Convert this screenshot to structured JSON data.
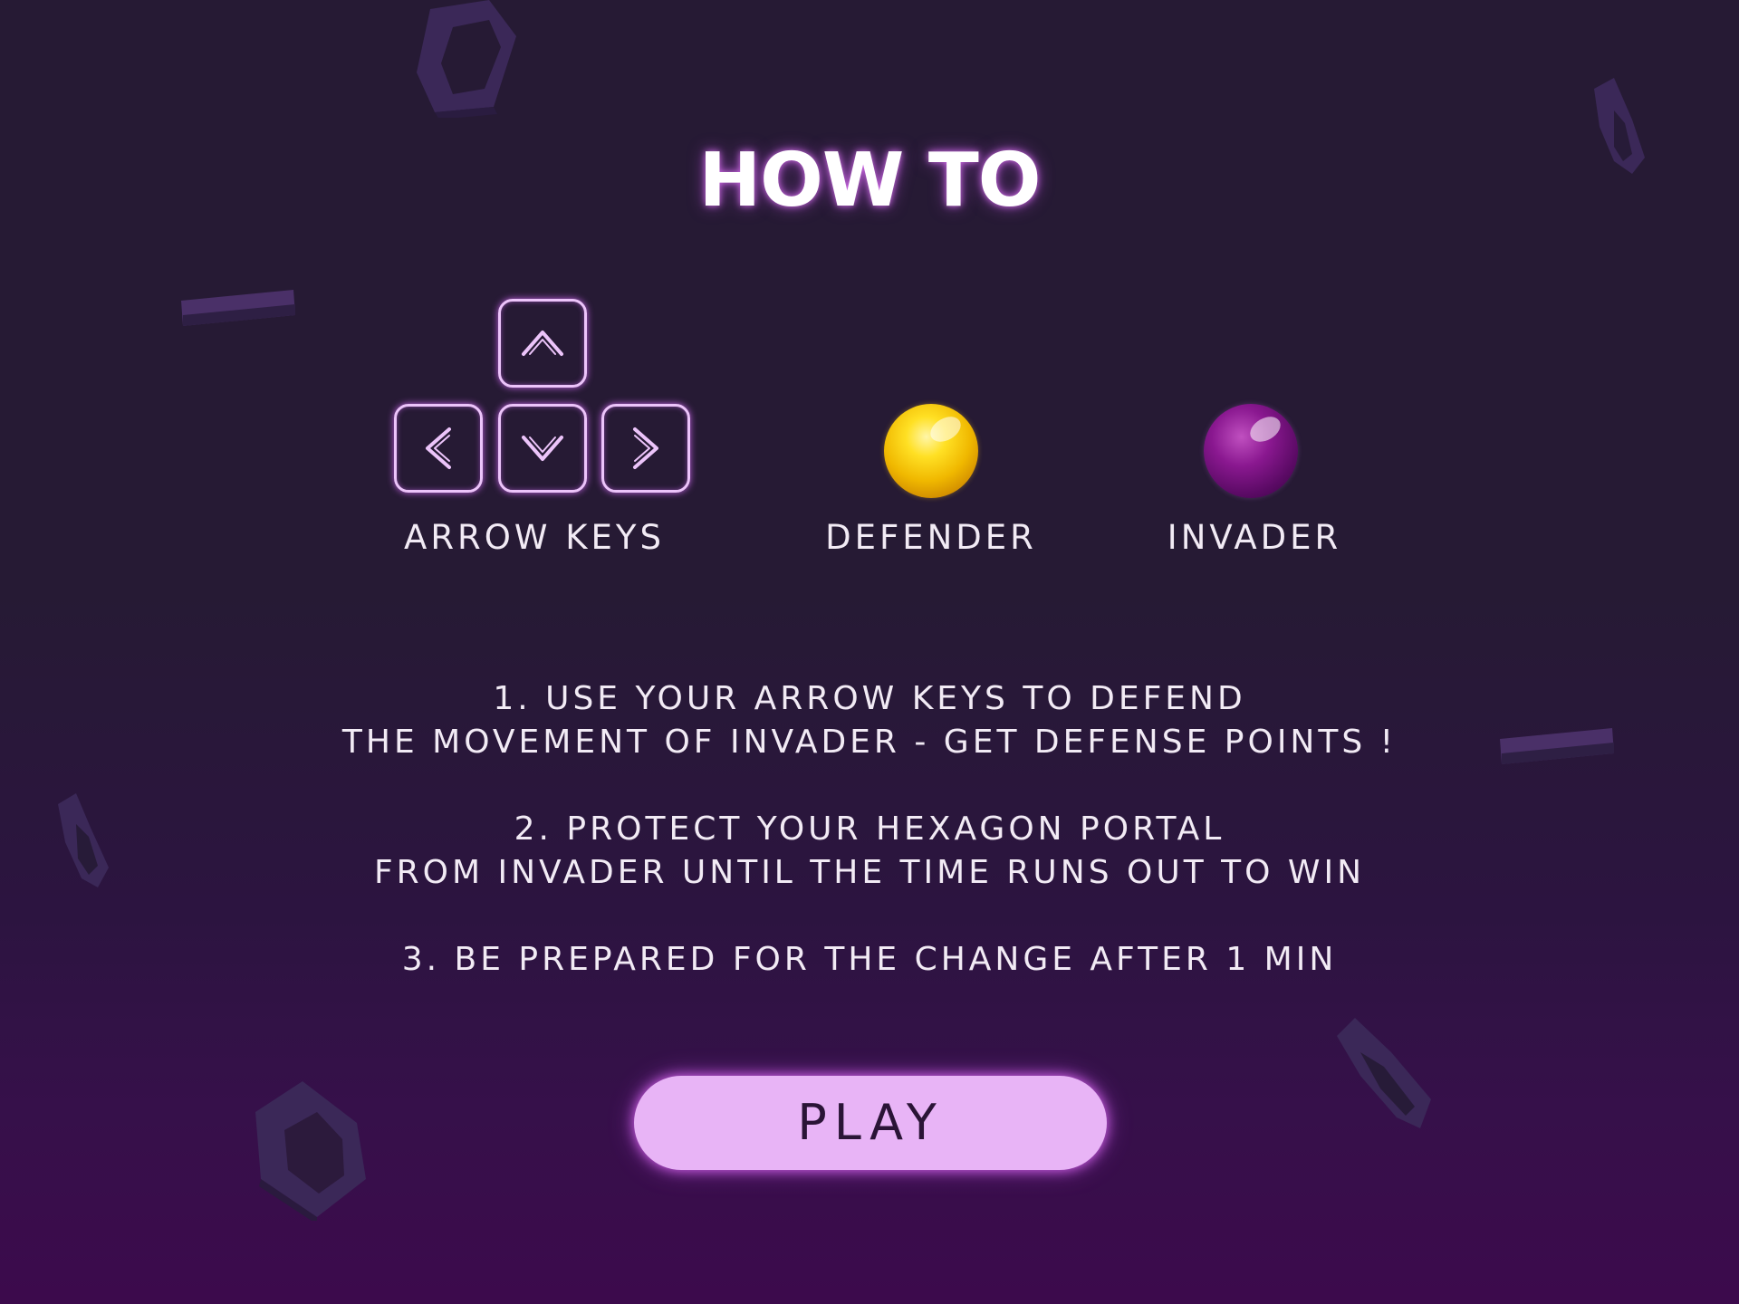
{
  "title": "HOW TO",
  "controls": [
    {
      "label": "ARROW KEYS",
      "icon": "arrow-keys-icon",
      "keys": [
        "up",
        "left",
        "down",
        "right"
      ]
    },
    {
      "label": "DEFENDER",
      "icon": "defender-orb-icon",
      "color": "#f5c400"
    },
    {
      "label": "INVADER",
      "icon": "invader-orb-icon",
      "color": "#7a1486"
    }
  ],
  "instructions": [
    [
      "1. USE YOUR ARROW KEYS TO DEFEND",
      "THE MOVEMENT OF INVADER - GET DEFENSE POINTS !"
    ],
    [
      "2. PROTECT YOUR HEXAGON PORTAL",
      "FROM INVADER UNTIL THE TIME RUNS OUT TO WIN"
    ],
    [
      "3. BE PREPARED FOR THE CHANGE AFTER 1 MIN"
    ]
  ],
  "play_label": "PLAY",
  "colors": {
    "background_top": "#261a34",
    "background_bottom": "#3c0a4c",
    "accent_glow": "#e070ff",
    "button_fill": "#e8b4f6",
    "hexagon_shard": "#3b2858"
  }
}
